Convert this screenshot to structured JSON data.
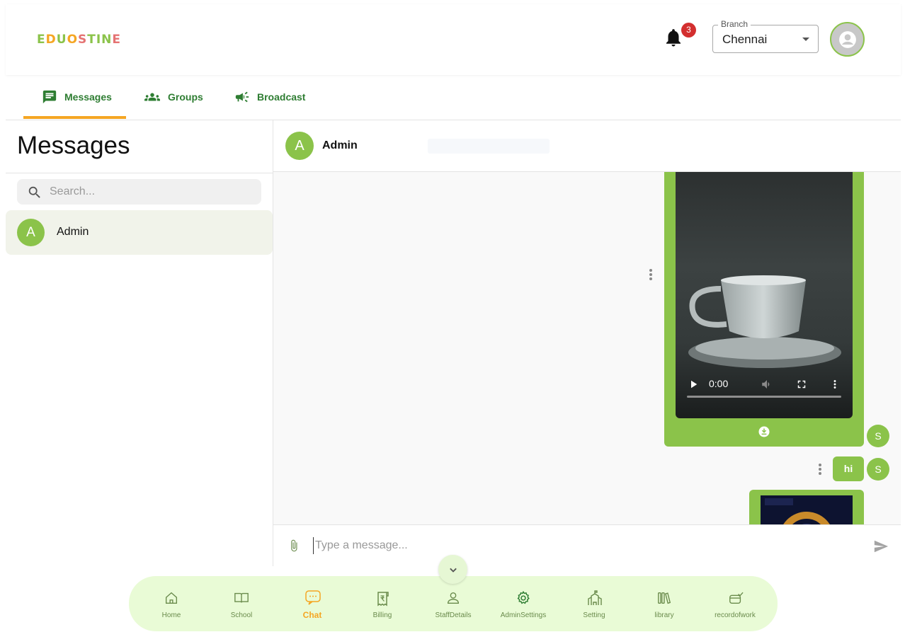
{
  "header": {
    "logo_text": "EDUOSTINE",
    "notifications": {
      "count": "3",
      "icon": "bell-icon"
    },
    "branch": {
      "label": "Branch",
      "value": "Chennai"
    },
    "profile_icon": "account-circle-icon"
  },
  "tabs": [
    {
      "label": "Messages",
      "icon": "chat-icon",
      "active": true
    },
    {
      "label": "Groups",
      "icon": "groups-icon",
      "active": false
    },
    {
      "label": "Broadcast",
      "icon": "megaphone-icon",
      "active": false
    }
  ],
  "sidebar": {
    "title": "Messages",
    "search_placeholder": "Search...",
    "contacts": [
      {
        "initial": "A",
        "name": "Admin",
        "selected": true
      }
    ]
  },
  "chat": {
    "header": {
      "initial": "A",
      "name": "Admin"
    },
    "messages": [
      {
        "type": "video",
        "time": "0:00",
        "sender_initial": "S"
      },
      {
        "type": "text",
        "text": "hi",
        "sender_initial": "S"
      },
      {
        "type": "image"
      }
    ],
    "composer_placeholder": "Type a message..."
  },
  "bottom_nav": [
    {
      "label": "Home",
      "icon": "home-icon",
      "active": false
    },
    {
      "label": "School",
      "icon": "book-icon",
      "active": false
    },
    {
      "label": "Chat",
      "icon": "chat-bubble-icon",
      "active": true
    },
    {
      "label": "Billing",
      "icon": "receipt-icon",
      "active": false
    },
    {
      "label": "StaffDetails",
      "icon": "person-icon",
      "active": false
    },
    {
      "label": "AdminSettings",
      "icon": "gear-icon",
      "active": false
    },
    {
      "label": "Setting",
      "icon": "building-icon",
      "active": false
    },
    {
      "label": "library",
      "icon": "library-icon",
      "active": false
    },
    {
      "label": "recordofwork",
      "icon": "record-icon",
      "active": false
    }
  ],
  "colors": {
    "accent_green": "#8bc34a",
    "dark_green": "#2e7d32",
    "accent_orange": "#f5a623",
    "badge_red": "#d32f2f",
    "nav_bg": "#e9fbd6"
  }
}
